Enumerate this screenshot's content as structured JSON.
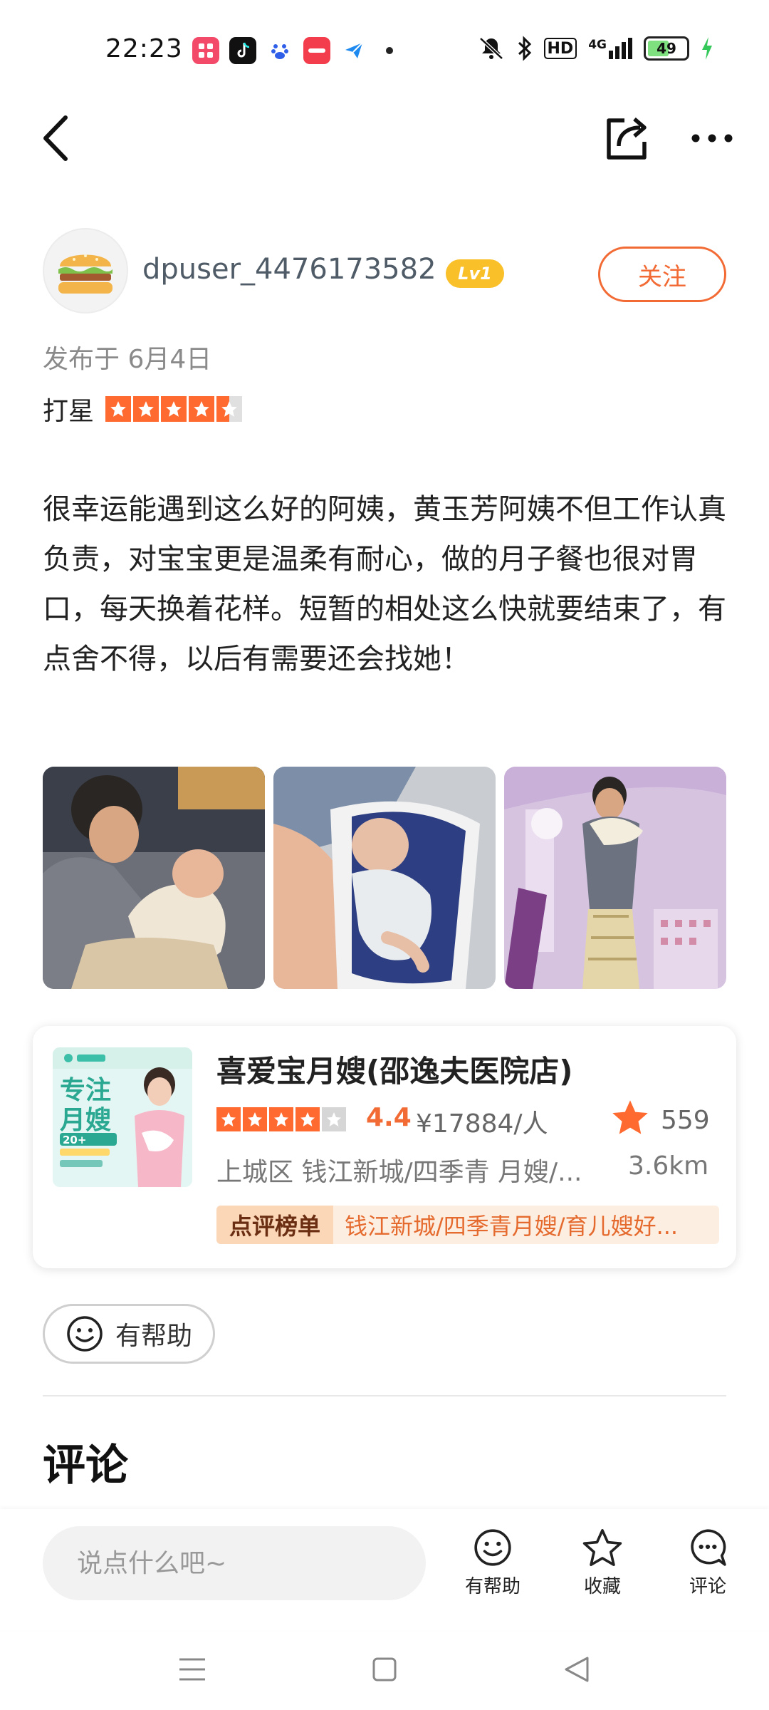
{
  "status_bar": {
    "time": "22:23",
    "network": "4G",
    "hd_label": "HD",
    "battery": "49"
  },
  "header": {
    "back_icon": "chevron-left-icon",
    "share_icon": "share-icon",
    "more_icon": "more-dots-icon"
  },
  "author": {
    "username": "dpuser_4476173582",
    "level": "Lv1",
    "follow_label": "关注"
  },
  "post": {
    "publish_date": "发布于 6月4日",
    "rating_label": "打星",
    "rating": 4.5,
    "text": "很幸运能遇到这么好的阿姨，黄玉芳阿姨不但工作认真负责，对宝宝更是温柔有耐心，做的月子餐也很对胃口，每天换着花样。短暂的相处这么快就要结束了，有点舍不得，以后有需要还会找她！",
    "photos": [
      "photo-1",
      "photo-2",
      "photo-3"
    ]
  },
  "shop": {
    "image_text_top": "专注",
    "image_text_bottom": "月嫂",
    "image_badge": "20+",
    "name": "喜爱宝月嫂(邵逸夫医院店)",
    "stars": 4,
    "score": "4.4",
    "price": "¥17884/人",
    "fav_count": "559",
    "location": "上城区 钱江新城/四季青 月嫂/...",
    "distance": "3.6km",
    "rank_tag": "点评榜单",
    "rank_text": "钱江新城/四季青月嫂/育儿嫂好..."
  },
  "helpful_label": "有帮助",
  "comments_title": "评论",
  "bottom_bar": {
    "input_placeholder": "说点什么吧~",
    "helpful": "有帮助",
    "favorite": "收藏",
    "comment": "评论"
  },
  "colors": {
    "accent": "#f26a34",
    "star": "#ff6a30",
    "level_badge": "#f9c02a"
  }
}
